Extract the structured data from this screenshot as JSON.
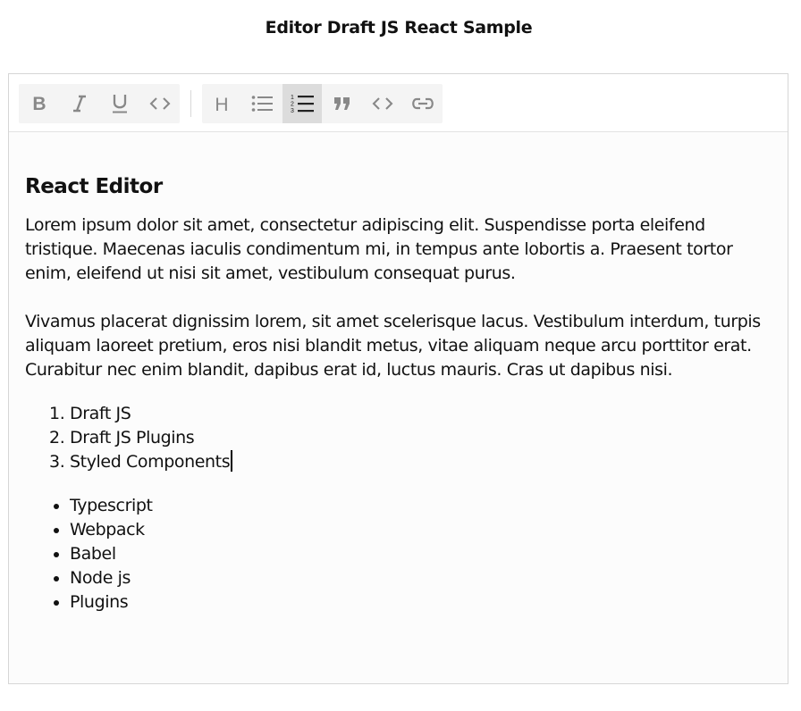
{
  "page": {
    "title": "Editor Draft JS React Sample"
  },
  "toolbar": {
    "inline_buttons": [
      {
        "icon": "bold-icon",
        "label": "B",
        "active": false
      },
      {
        "icon": "italic-icon",
        "label": "I",
        "active": false
      },
      {
        "icon": "underline-icon",
        "label": "U",
        "active": false
      },
      {
        "icon": "code-icon",
        "label": "<>",
        "active": false
      }
    ],
    "block_buttons": [
      {
        "icon": "heading-icon",
        "label": "H",
        "active": false
      },
      {
        "icon": "unordered-list-icon",
        "active": false
      },
      {
        "icon": "ordered-list-icon",
        "active": true
      },
      {
        "icon": "blockquote-icon",
        "active": false
      },
      {
        "icon": "code-block-icon",
        "active": false
      },
      {
        "icon": "link-icon",
        "active": false
      }
    ],
    "icon_color": "#888888",
    "active_color": "#222222"
  },
  "editor": {
    "heading": "React Editor",
    "paragraphs": [
      "Lorem ipsum dolor sit amet, consectetur adipiscing elit. Suspendisse porta eleifend tristique. Maecenas iaculis condimentum mi, in tempus ante lobortis a. Praesent tortor enim, eleifend ut nisi sit amet, vestibulum consequat purus.",
      "Vivamus placerat dignissim lorem, sit amet scelerisque lacus. Vestibulum interdum, turpis aliquam laoreet pretium, eros nisi blandit metus, vitae aliquam neque arcu porttitor erat. Curabitur nec enim blandit, dapibus erat id, luctus mauris. Cras ut dapibus nisi."
    ],
    "ordered_list": [
      "Draft JS",
      "Draft JS Plugins",
      "Styled Components"
    ],
    "unordered_list": [
      "Typescript",
      "Webpack",
      "Babel",
      "Node js",
      "Plugins"
    ]
  }
}
